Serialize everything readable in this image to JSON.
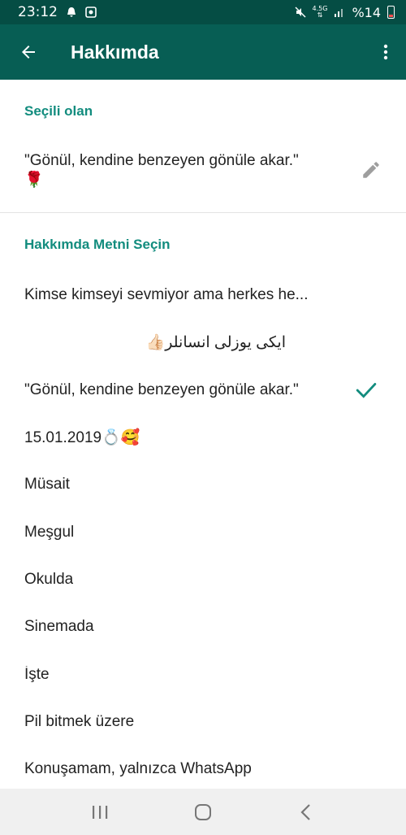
{
  "status_bar": {
    "time": "23:12",
    "network": "4.5G",
    "battery": "%14"
  },
  "app_bar": {
    "title": "Hakkımda",
    "back_icon": "arrow-back-icon",
    "more_icon": "more-vert-icon"
  },
  "current": {
    "header": "Seçili olan",
    "text": "\"Gönül, kendine benzeyen gönüle akar.\"",
    "emoji": "🌹",
    "edit_icon": "pencil-icon"
  },
  "choose": {
    "header": "Hakkımda Metni Seçin",
    "items": [
      {
        "label": "Kimse kimseyi sevmiyor ama herkes he..."
      },
      {
        "label": "ايكى يوزلى انسانلر👍🏻"
      },
      {
        "label": "\"Gönül, kendine benzeyen gönüle akar.\"",
        "selected": true
      },
      {
        "label": "15.01.2019💍🥰"
      },
      {
        "label": "Müsait"
      },
      {
        "label": "Meşgul"
      },
      {
        "label": "Okulda"
      },
      {
        "label": "Sinemada"
      },
      {
        "label": "İşte"
      },
      {
        "label": "Pil bitmek üzere"
      },
      {
        "label": "Konuşamam, yalnızca WhatsApp"
      }
    ]
  },
  "colors": {
    "primary": "#075e54",
    "status_bar": "#054d44",
    "accent": "#128c7e"
  }
}
